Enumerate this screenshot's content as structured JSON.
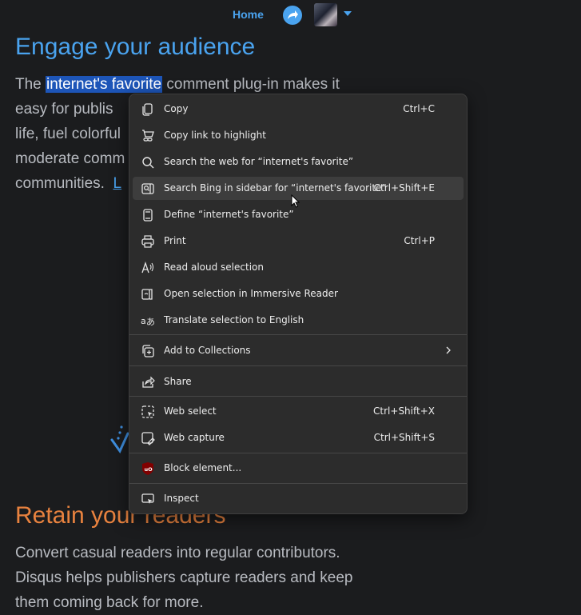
{
  "nav": {
    "home_label": "Home",
    "share_icon": "share-icon",
    "avatar": "avatar"
  },
  "content": {
    "heading1": "Engage your audience",
    "para1_before": "The ",
    "para1_highlight": "internet's favorite",
    "para1_after": " comment plug-in makes it easy for publis",
    "para1_line3": "life, fuel colorful",
    "para1_line4": "moderate comm",
    "para1_line5_text": "communities.",
    "para1_link": "L",
    "heading2": "Retain your readers",
    "para2": "Convert casual readers into regular contributors. Disqus helps publishers capture readers and keep them coming back for more."
  },
  "context_menu": {
    "items": [
      {
        "label": "Copy",
        "shortcut": "Ctrl+C",
        "icon": "copy-icon"
      },
      {
        "label": "Copy link to highlight",
        "shortcut": "",
        "icon": "link-highlight-icon"
      },
      {
        "label": "Search the web for “internet's favorite”",
        "shortcut": "",
        "icon": "search-icon"
      },
      {
        "label": "Search Bing in sidebar for “internet's favorite”",
        "shortcut": "Ctrl+Shift+E",
        "icon": "sidebar-search-icon"
      },
      {
        "label": "Define “internet's favorite”",
        "shortcut": "",
        "icon": "book-icon"
      },
      {
        "label": "Print",
        "shortcut": "Ctrl+P",
        "icon": "printer-icon"
      },
      {
        "label": "Read aloud selection",
        "shortcut": "",
        "icon": "read-aloud-icon"
      },
      {
        "label": "Open selection in Immersive Reader",
        "shortcut": "",
        "icon": "immersive-reader-icon"
      },
      {
        "label": "Translate selection to English",
        "shortcut": "",
        "icon": "translate-icon"
      },
      {
        "label": "Add to Collections",
        "shortcut": "",
        "icon": "collections-icon"
      },
      {
        "label": "Share",
        "shortcut": "",
        "icon": "share-icon"
      },
      {
        "label": "Web select",
        "shortcut": "Ctrl+Shift+X",
        "icon": "web-select-icon"
      },
      {
        "label": "Web capture",
        "shortcut": "Ctrl+Shift+S",
        "icon": "web-capture-icon"
      },
      {
        "label": "Block element...",
        "shortcut": "",
        "icon": "ublock-icon"
      },
      {
        "label": "Inspect",
        "shortcut": "",
        "icon": "inspect-icon"
      }
    ]
  },
  "colors": {
    "accent_blue": "#4aa3ef",
    "accent_orange": "#e8823f",
    "selection": "#1d55b8",
    "menu_bg": "#2c2c2c"
  }
}
